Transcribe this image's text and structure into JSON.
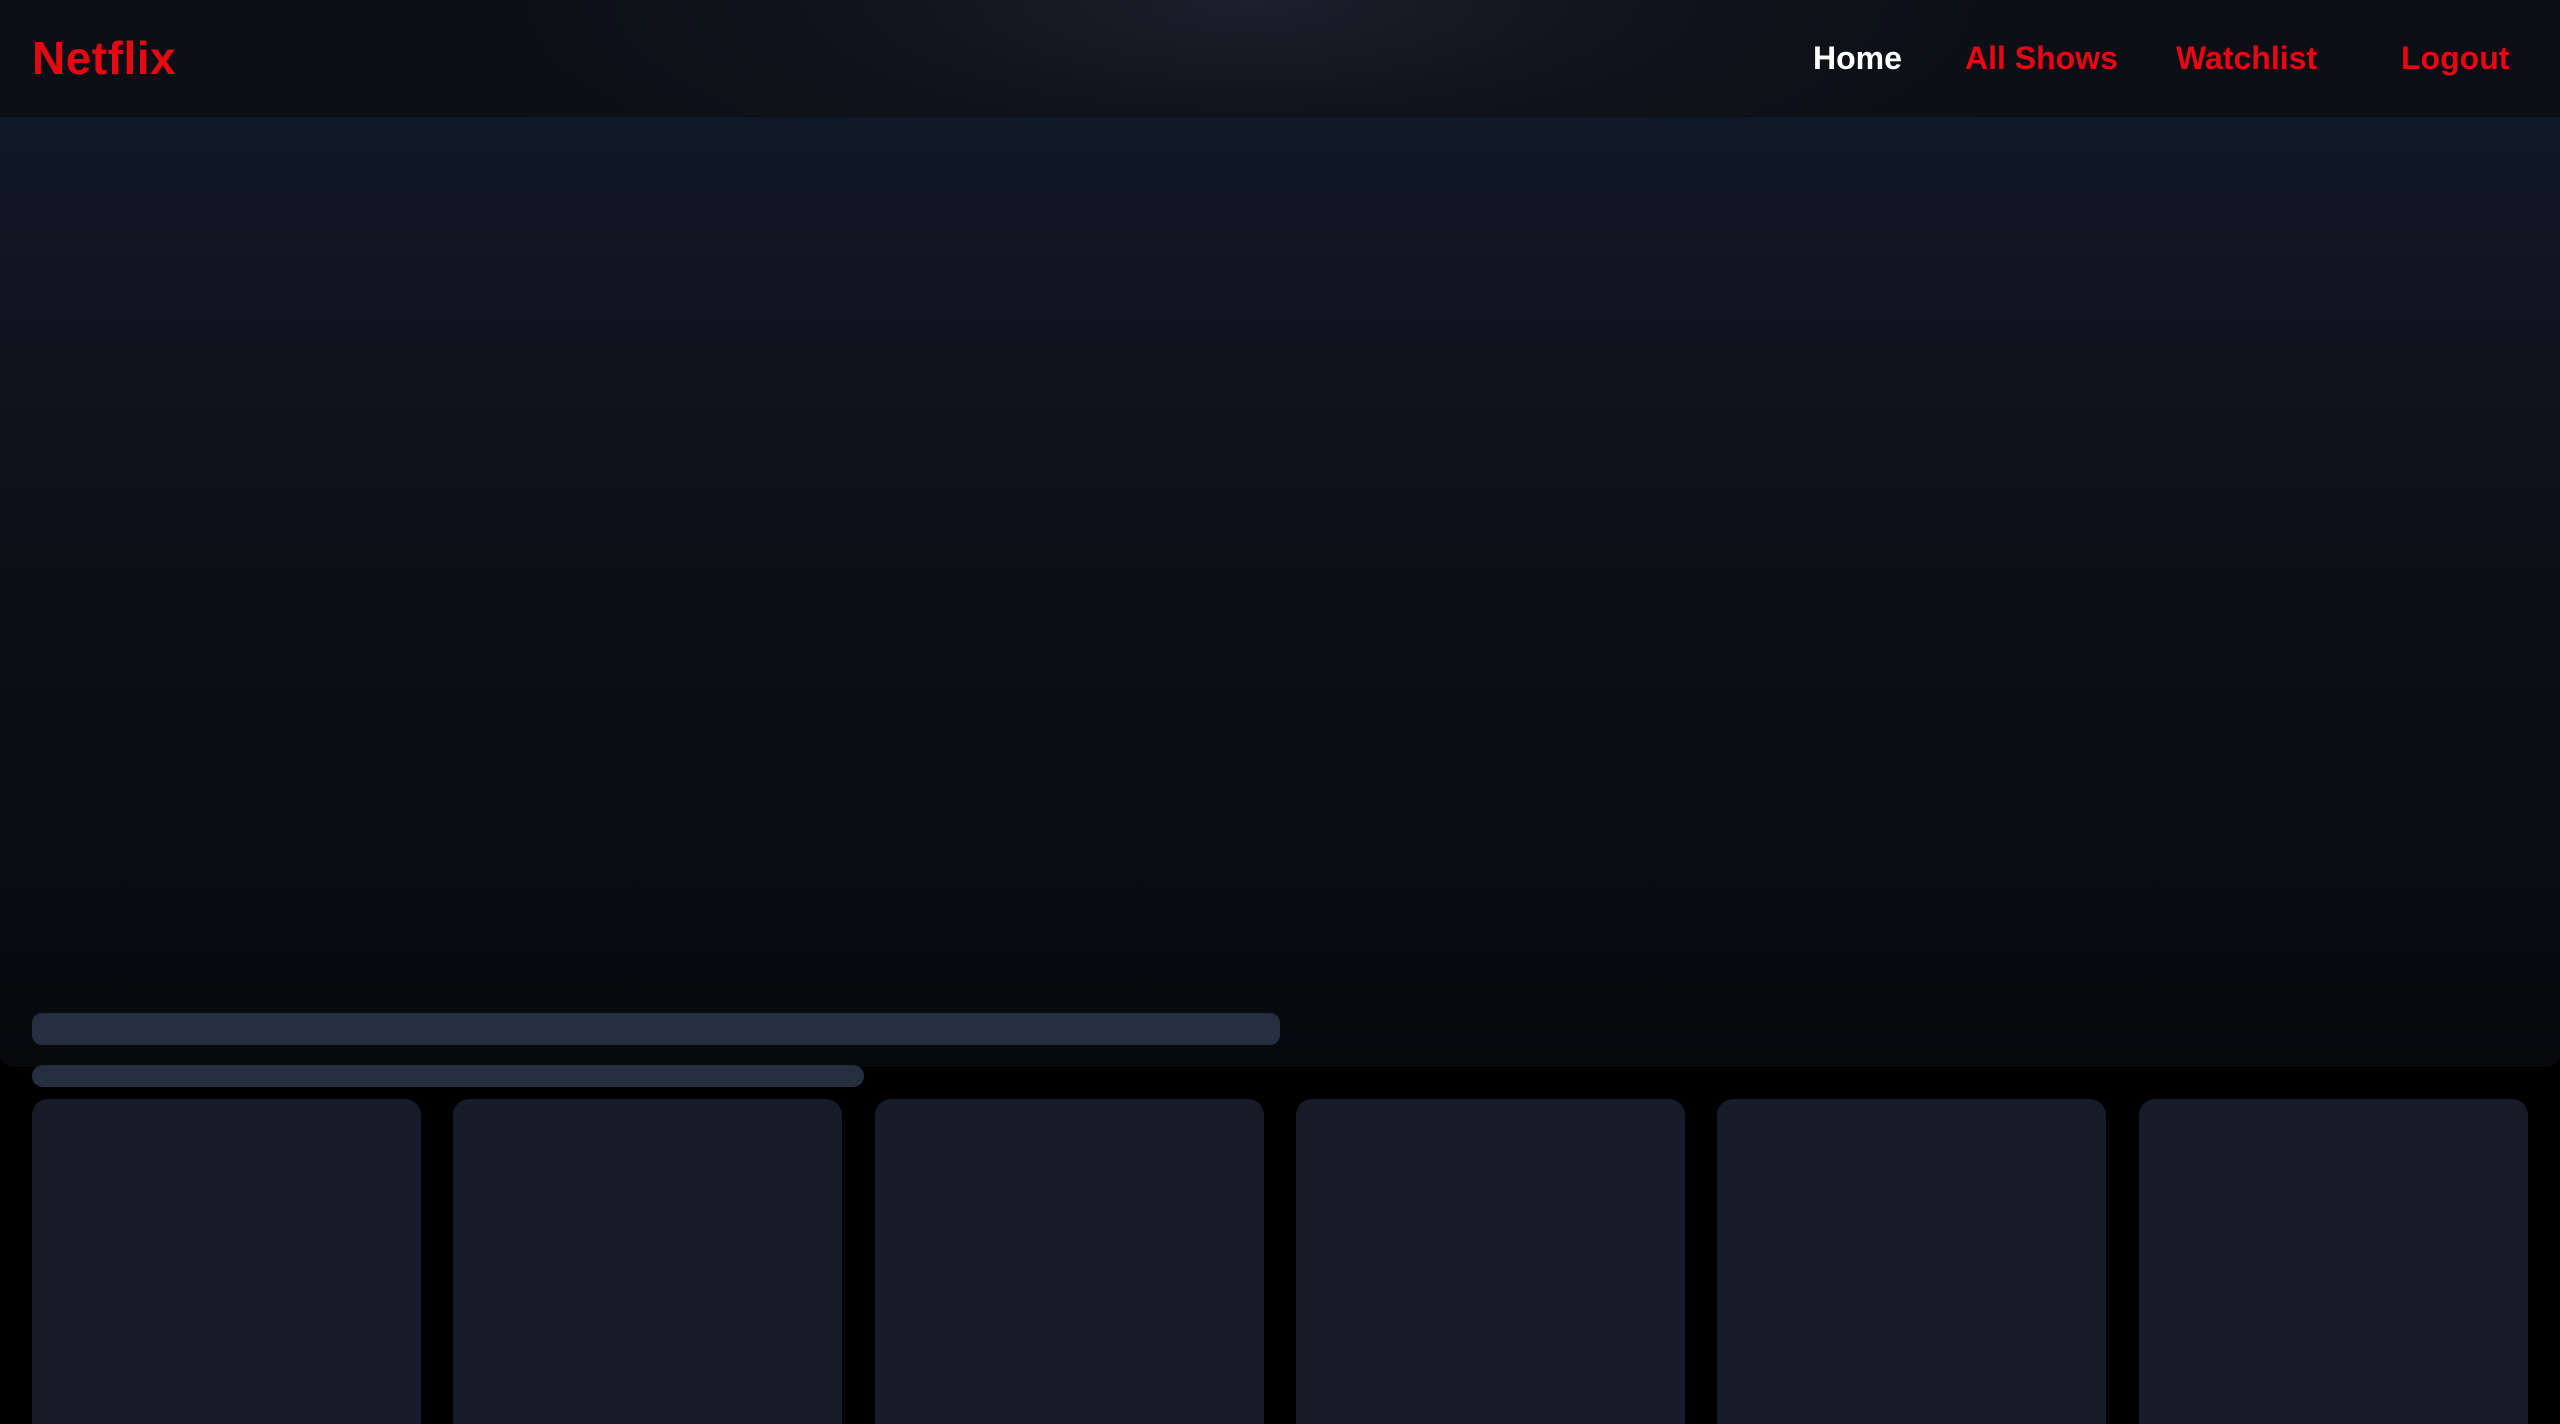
{
  "header": {
    "logo": "Netflix",
    "nav": {
      "home": "Home",
      "all_shows": "All Shows",
      "watchlist": "Watchlist",
      "logout": "Logout"
    },
    "active_item": "Home"
  },
  "colors": {
    "brand": "#e50914",
    "nav_active": "#ffffff",
    "skeleton": "#262f40",
    "card": "#161c28",
    "background": "#000000"
  },
  "hero": {
    "state": "loading"
  },
  "cards": {
    "count": 6,
    "state": "loading"
  }
}
